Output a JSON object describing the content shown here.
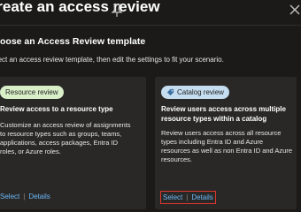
{
  "header": {
    "title": "Create an access review",
    "pin_icon": "pin-icon",
    "close_icon": "close-icon"
  },
  "intro": {
    "heading": "Choose an Access Review template",
    "description": "Select an access review template, then edit the settings to fit your scenario."
  },
  "cards": [
    {
      "badge": "Resource review",
      "badge_color": "#d8efc8",
      "title": "Review access to a resource type",
      "body": "Customize an access review of assignments to resource types such as groups, teams, applications, access packages, Entra ID roles, or Azure roles.",
      "select_label": "Select",
      "details_label": "Details"
    },
    {
      "badge": "Catalog review",
      "badge_color": "#c5ddf0",
      "badge_icon": "catalog-icon",
      "title": "Review users access across multiple resource types within a catalog",
      "body": "Review users access across all resource types including Entra ID and Azure resources as well as non Entra ID and Azure resources.",
      "select_label": "Select",
      "details_label": "Details"
    }
  ]
}
